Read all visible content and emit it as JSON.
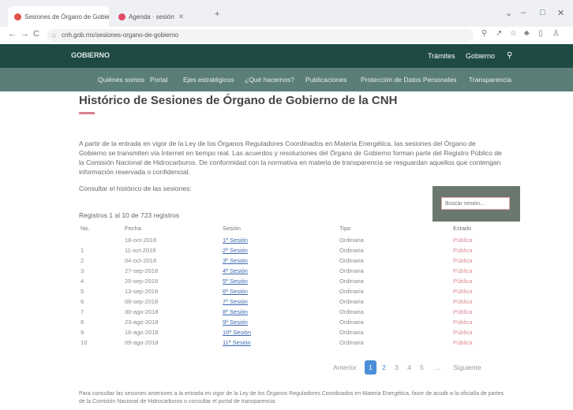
{
  "browser": {
    "tabs": [
      {
        "label": "Sesiones de Órgano de Gobier..."
      },
      {
        "label": "Agenda · sesión"
      }
    ],
    "new_tab": "+",
    "url": "cnh.gob.mx/sesiones-organo-de-gobierno",
    "nav": {
      "back": "←",
      "forward": "→",
      "reload": "C"
    },
    "window_controls": {
      "minimize": "–",
      "maximize": "□",
      "close": "✕"
    }
  },
  "site": {
    "logo": "GOBIERNO",
    "top_links": [
      "Trámites",
      "Gobierno"
    ],
    "menu": [
      "Quiénes somos",
      "Portal",
      "Ejes estratégicos",
      "¿Qué hacemos?",
      "Publicaciones",
      "Protección de Datos Personales",
      "Transparencia"
    ]
  },
  "main": {
    "title": "Histórico de Sesiones de Órgano de Gobierno de la CNH",
    "intro": "A partir de la entrada en vigor de la Ley de los Órganos Reguladores Coordinados en Materia Energética, las sesiones del Órgano de Gobierno se transmiten vía Internet en tiempo real. Las acuerdos y resoluciones del Órgano de Gobierno forman parte del Registro Público de la Comisión Nacional de Hidrocarburos. De conformidad con la normativa en materia de transparencia se resguardan aquellos que contengan información reservada o confidencial.",
    "consult": "Consultar el histórico de las sesiones:",
    "search_placeholder": "Buscar sesión...",
    "records": "Registros 1 al 10 de 723 registros",
    "table": {
      "headers": [
        "No.",
        "Fecha",
        "Sesión",
        "Tipo",
        "Estado"
      ],
      "rows": [
        [
          "",
          "18-oct-2018",
          "1ª Sesión",
          "Ordinaria",
          "Pública"
        ],
        [
          "1",
          "11-oct-2018",
          "2ª Sesión",
          "Ordinaria",
          "Pública"
        ],
        [
          "2",
          "04-oct-2018",
          "3ª Sesión",
          "Ordinaria",
          "Pública"
        ],
        [
          "3",
          "27-sep-2018",
          "4ª Sesión",
          "Ordinaria",
          "Pública"
        ],
        [
          "4",
          "20-sep-2018",
          "5ª Sesión",
          "Ordinaria",
          "Pública"
        ],
        [
          "5",
          "13-sep-2018",
          "6ª Sesión",
          "Ordinaria",
          "Pública"
        ],
        [
          "6",
          "06-sep-2018",
          "7ª Sesión",
          "Ordinaria",
          "Pública"
        ],
        [
          "7",
          "30-ago-2018",
          "8ª Sesión",
          "Ordinaria",
          "Pública"
        ],
        [
          "8",
          "23-ago-2018",
          "9ª Sesión",
          "Ordinaria",
          "Pública"
        ],
        [
          "9",
          "16-ago-2018",
          "10ª Sesión",
          "Ordinaria",
          "Pública"
        ],
        [
          "10",
          "09-ago-2018",
          "11ª Sesión",
          "Ordinaria",
          "Pública"
        ]
      ]
    },
    "pagination": {
      "previous": "Anterior",
      "pages": [
        "1",
        "2",
        "3",
        "4",
        "5"
      ],
      "ellipsis": "...",
      "next": "Siguiente",
      "active": "1"
    },
    "footnote": "Para consultar las sesiones anteriores a la entrada en vigor de la Ley de los Órganos Reguladores Coordinados en Materia Energética, favor de acudir a la oficialía de partes de la Comisión Nacional de Hidrocarburos o consultar el portal de transparencia."
  },
  "colors": {
    "header": "#1e4a43",
    "nav": "#5b7f78",
    "accent": "#d8828f",
    "link": "#3c69b0",
    "page_active": "#4a8fd8"
  }
}
